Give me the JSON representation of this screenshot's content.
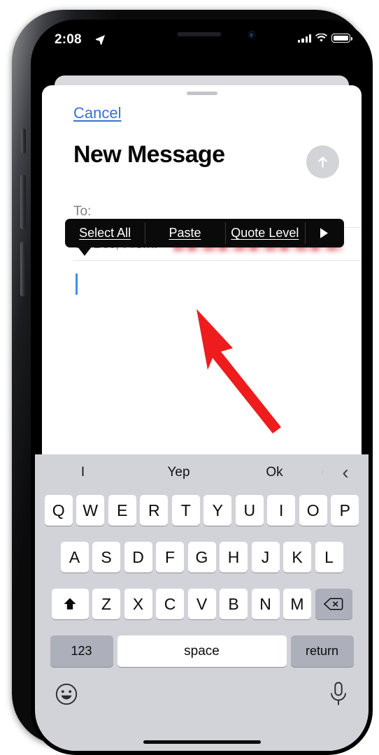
{
  "status_bar": {
    "time": "2:08",
    "location_icon": "location-arrow-icon",
    "signal_icon": "cellular-signal-icon",
    "wifi_icon": "wifi-icon",
    "battery_icon": "battery-full-icon"
  },
  "compose": {
    "cancel_label": "Cancel",
    "title": "New Message",
    "send_icon": "send-arrow-up-icon",
    "fields": [
      {
        "label": "To:",
        "value": ""
      },
      {
        "label": "Cc/Bcc, From:",
        "value": "",
        "redacted": true
      }
    ],
    "body_text": ""
  },
  "context_menu": {
    "items": [
      {
        "label": "Select All"
      },
      {
        "label": "Paste"
      },
      {
        "label": "Quote Level"
      }
    ],
    "more_icon": "chevron-right-triangle-icon"
  },
  "annotation": {
    "arrow_color": "#ee1c1c",
    "points_to": "Paste"
  },
  "keyboard": {
    "predictions": [
      "I",
      "Yep",
      "Ok"
    ],
    "prediction_nav_icon": "chevron-left-icon",
    "row1": [
      "Q",
      "W",
      "E",
      "R",
      "T",
      "Y",
      "U",
      "I",
      "O",
      "P"
    ],
    "row2": [
      "A",
      "S",
      "D",
      "F",
      "G",
      "H",
      "J",
      "K",
      "L"
    ],
    "row3": [
      "Z",
      "X",
      "C",
      "V",
      "B",
      "N",
      "M"
    ],
    "shift_icon": "shift-up-arrow-icon",
    "delete_icon": "backspace-delete-icon",
    "numbers_label": "123",
    "space_label": "space",
    "return_label": "return",
    "emoji_icon": "emoji-smiley-icon",
    "mic_icon": "microphone-icon"
  },
  "colors": {
    "link_blue": "#3a6fd8",
    "caret_blue": "#3d8ef0",
    "menu_black": "#0a0a0a",
    "keyboard_bg": "#d1d3d9",
    "key_gray": "#adb0ba",
    "annotation_red": "#ee1c1c"
  }
}
